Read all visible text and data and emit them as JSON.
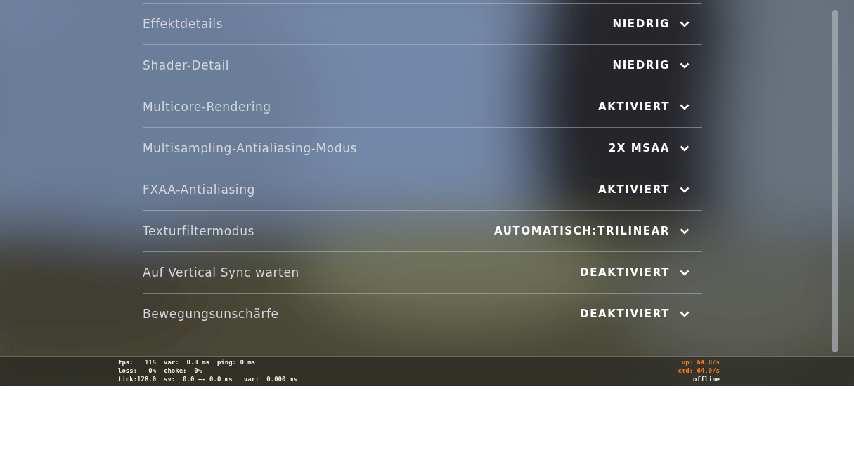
{
  "settings": [
    {
      "label": "Effektdetails",
      "value": "NIEDRIG"
    },
    {
      "label": "Shader-Detail",
      "value": "NIEDRIG"
    },
    {
      "label": "Multicore-Rendering",
      "value": "AKTIVIERT"
    },
    {
      "label": "Multisampling-Antialiasing-Modus",
      "value": "2X MSAA"
    },
    {
      "label": "FXAA-Antialiasing",
      "value": "AKTIVIERT"
    },
    {
      "label": "Texturfiltermodus",
      "value": "AUTOMATISCH:TRILINEAR"
    },
    {
      "label": "Auf Vertical Sync warten",
      "value": "DEAKTIVIERT"
    },
    {
      "label": "Bewegungsunschärfe",
      "value": "DEAKTIVIERT"
    }
  ],
  "net_graph": {
    "left_lines": [
      "fps:   115  var:  0.3 ms  ping: 0 ms",
      "loss:   0%  choke:  0%",
      "tick:128.0  sv:  0.0 +- 0.0 ms   var:  0.000 ms"
    ],
    "right_lines": [
      {
        "text": "up: 64.0/s",
        "color": "#ff7a1a"
      },
      {
        "text": "cmd: 64.0/s",
        "color": "#ff7a1a"
      },
      {
        "text": "offline",
        "color": "#f0f0e0"
      }
    ]
  }
}
